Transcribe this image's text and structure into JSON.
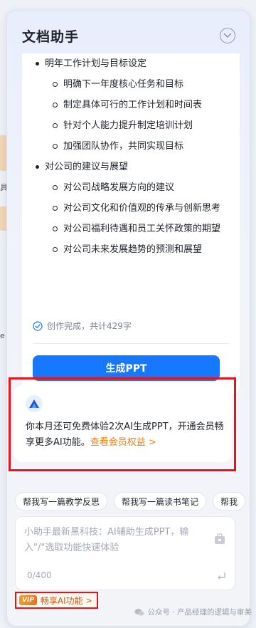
{
  "background": {
    "left_glyphs": [
      "具",
      "e"
    ]
  },
  "panel": {
    "title": "文档助手",
    "outline": [
      {
        "level": 1,
        "text": "明年工作计划与目标设定"
      },
      {
        "level": 2,
        "text": "明确下一年度核心任务和目标"
      },
      {
        "level": 2,
        "text": "制定具体可行的工作计划和时间表"
      },
      {
        "level": 2,
        "text": "针对个人能力提升制定培训计划"
      },
      {
        "level": 2,
        "text": "加强团队协作，共同实现目标"
      },
      {
        "level": 1,
        "text": "对公司的建议与展望"
      },
      {
        "level": 2,
        "text": "对公司战略发展方向的建议"
      },
      {
        "level": 2,
        "text": "对公司文化和价值观的传承与创新思考"
      },
      {
        "level": 2,
        "text": "对公司福利待遇和员工关怀政策的期望"
      },
      {
        "level": 2,
        "text": "对公司未来发展趋势的预测和展望"
      }
    ],
    "status": "创作完成，共计429字",
    "generate_label": "生成PPT",
    "quota": {
      "text": "你本月还可免费体验2次AI生成PPT，开通会员畅享更多AI功能。",
      "link": "查看会员权益 >"
    },
    "chips": [
      "帮我写一篇教学反思",
      "帮我写一篇读书笔记",
      "帮我"
    ],
    "input": {
      "placeholder": "小助手最新黑科技：AI辅助生成PPT，输入\"/\"选取功能快速体验",
      "count": "0/400"
    },
    "vip": {
      "badge": "VIP",
      "label": "畅享AI功能",
      "chevron": ">"
    }
  },
  "watermark": "公众号 · 产品经理的逻辑与审美",
  "colors": {
    "primary": "#1677ff",
    "accent_orange": "#f07d10",
    "highlight_red": "#e8121c"
  }
}
